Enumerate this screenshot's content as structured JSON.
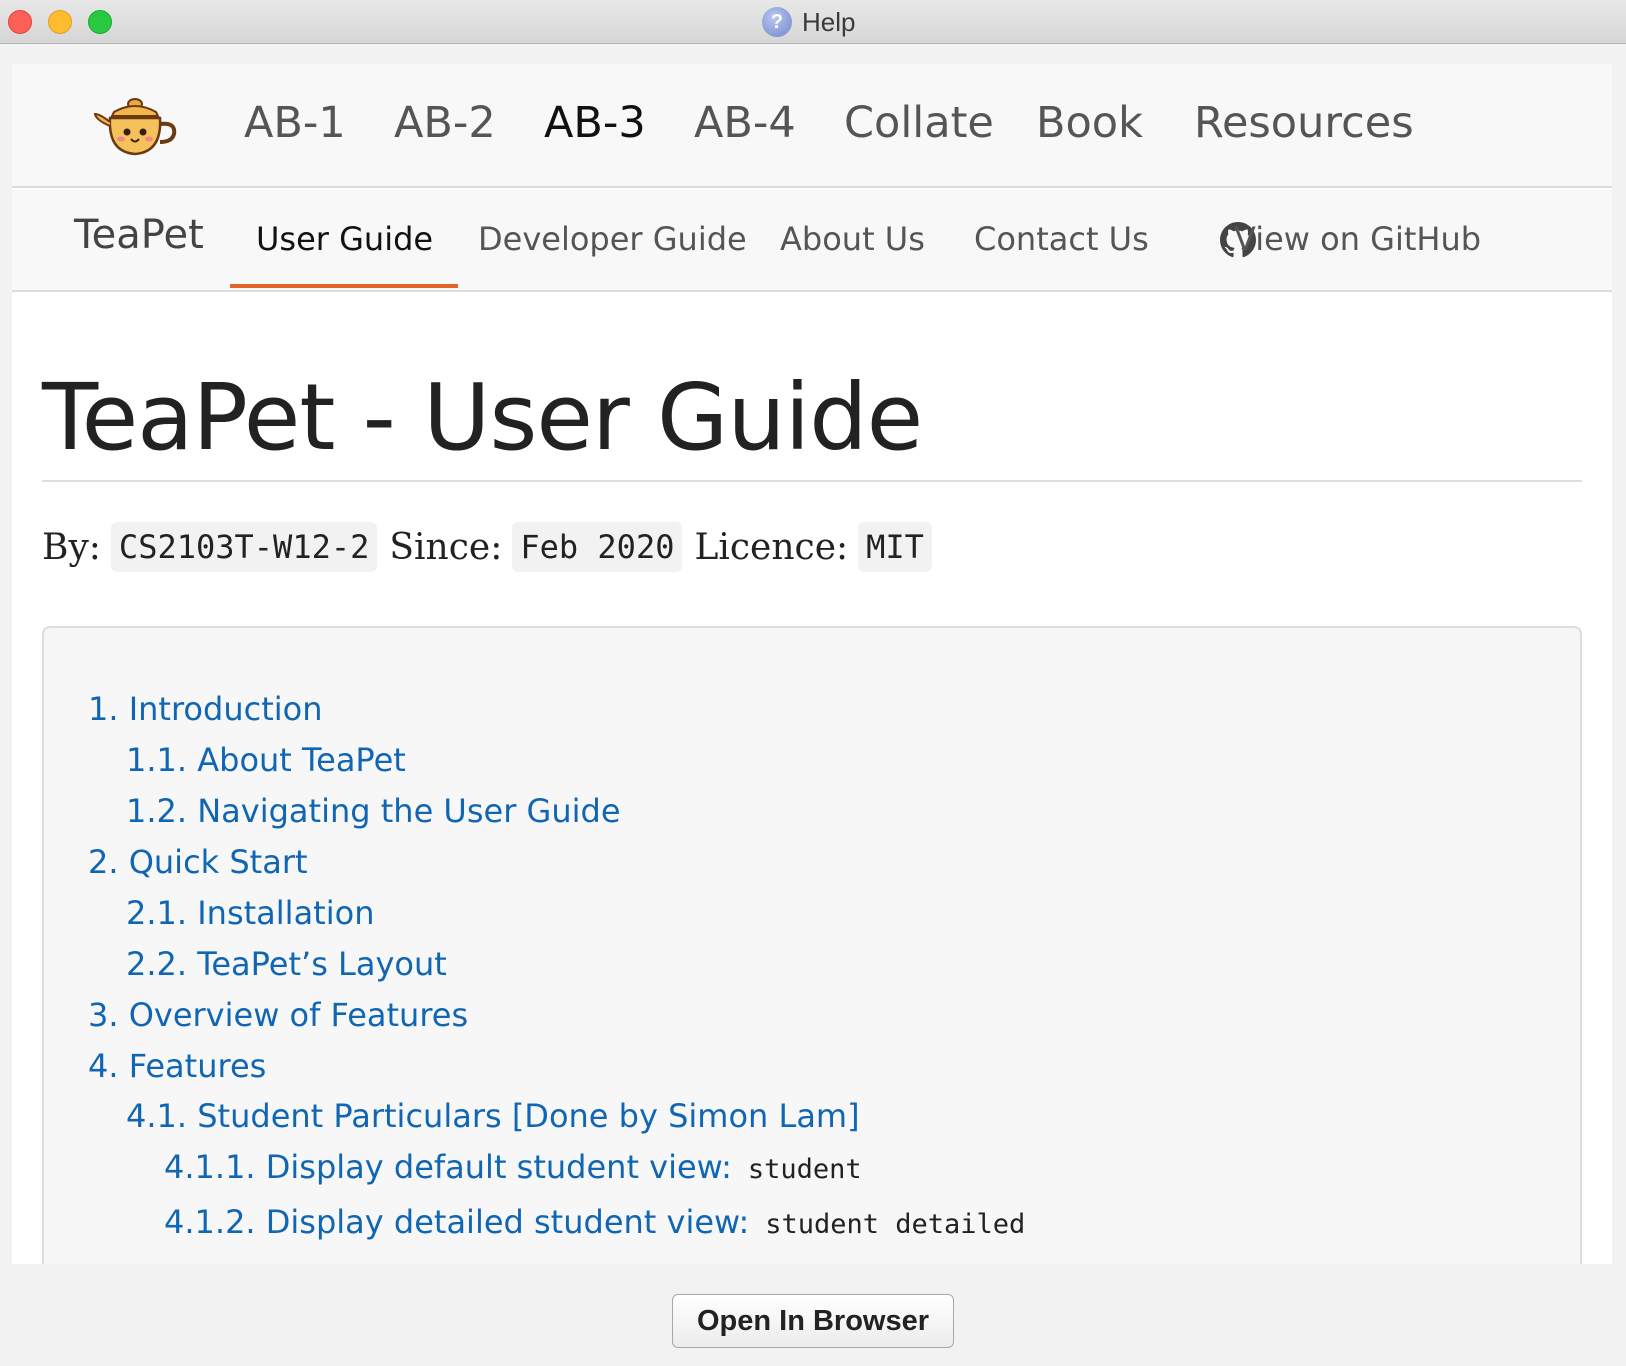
{
  "window": {
    "title": "Help",
    "help_icon_glyph": "?"
  },
  "topnav": {
    "items": [
      {
        "label": "AB-1",
        "active": false
      },
      {
        "label": "AB-2",
        "active": false
      },
      {
        "label": "AB-3",
        "active": true
      },
      {
        "label": "AB-4",
        "active": false
      },
      {
        "label": "Collate",
        "active": false
      },
      {
        "label": "Book",
        "active": false
      },
      {
        "label": "Resources",
        "active": false
      }
    ]
  },
  "subnav": {
    "brand": "TeaPet",
    "items": [
      {
        "label": "User Guide",
        "active": true
      },
      {
        "label": "Developer Guide",
        "active": false
      },
      {
        "label": "About Us",
        "active": false
      },
      {
        "label": "Contact Us",
        "active": false
      },
      {
        "label": "View on GitHub",
        "active": false,
        "icon": "github-icon"
      }
    ],
    "accent_color": "#e0672a"
  },
  "page": {
    "title": "TeaPet - User Guide",
    "meta": {
      "by_label": "By:",
      "by_value": "CS2103T-W12-2",
      "since_label": "Since:",
      "since_value": "Feb 2020",
      "licence_label": "Licence:",
      "licence_value": "MIT"
    }
  },
  "toc": {
    "link_color": "#1166b4",
    "items": [
      {
        "text": "1. Introduction",
        "level": 1,
        "code": ""
      },
      {
        "text": "1.1. About TeaPet",
        "level": 2,
        "code": ""
      },
      {
        "text": "1.2. Navigating the User Guide",
        "level": 2,
        "code": ""
      },
      {
        "text": "2. Quick Start",
        "level": 1,
        "code": ""
      },
      {
        "text": "2.1. Installation",
        "level": 2,
        "code": ""
      },
      {
        "text": "2.2. TeaPet’s Layout",
        "level": 2,
        "code": ""
      },
      {
        "text": "3. Overview of Features",
        "level": 1,
        "code": ""
      },
      {
        "text": "4. Features",
        "level": 1,
        "code": ""
      },
      {
        "text": "4.1. Student Particulars [Done by Simon Lam]",
        "level": 2,
        "code": ""
      },
      {
        "text": "4.1.1. Display default student view:",
        "level": 3,
        "code": "student"
      },
      {
        "text": "4.1.2. Display detailed student view:",
        "level": 3,
        "code": "student detailed"
      }
    ]
  },
  "footer": {
    "open_button_label": "Open In Browser"
  }
}
